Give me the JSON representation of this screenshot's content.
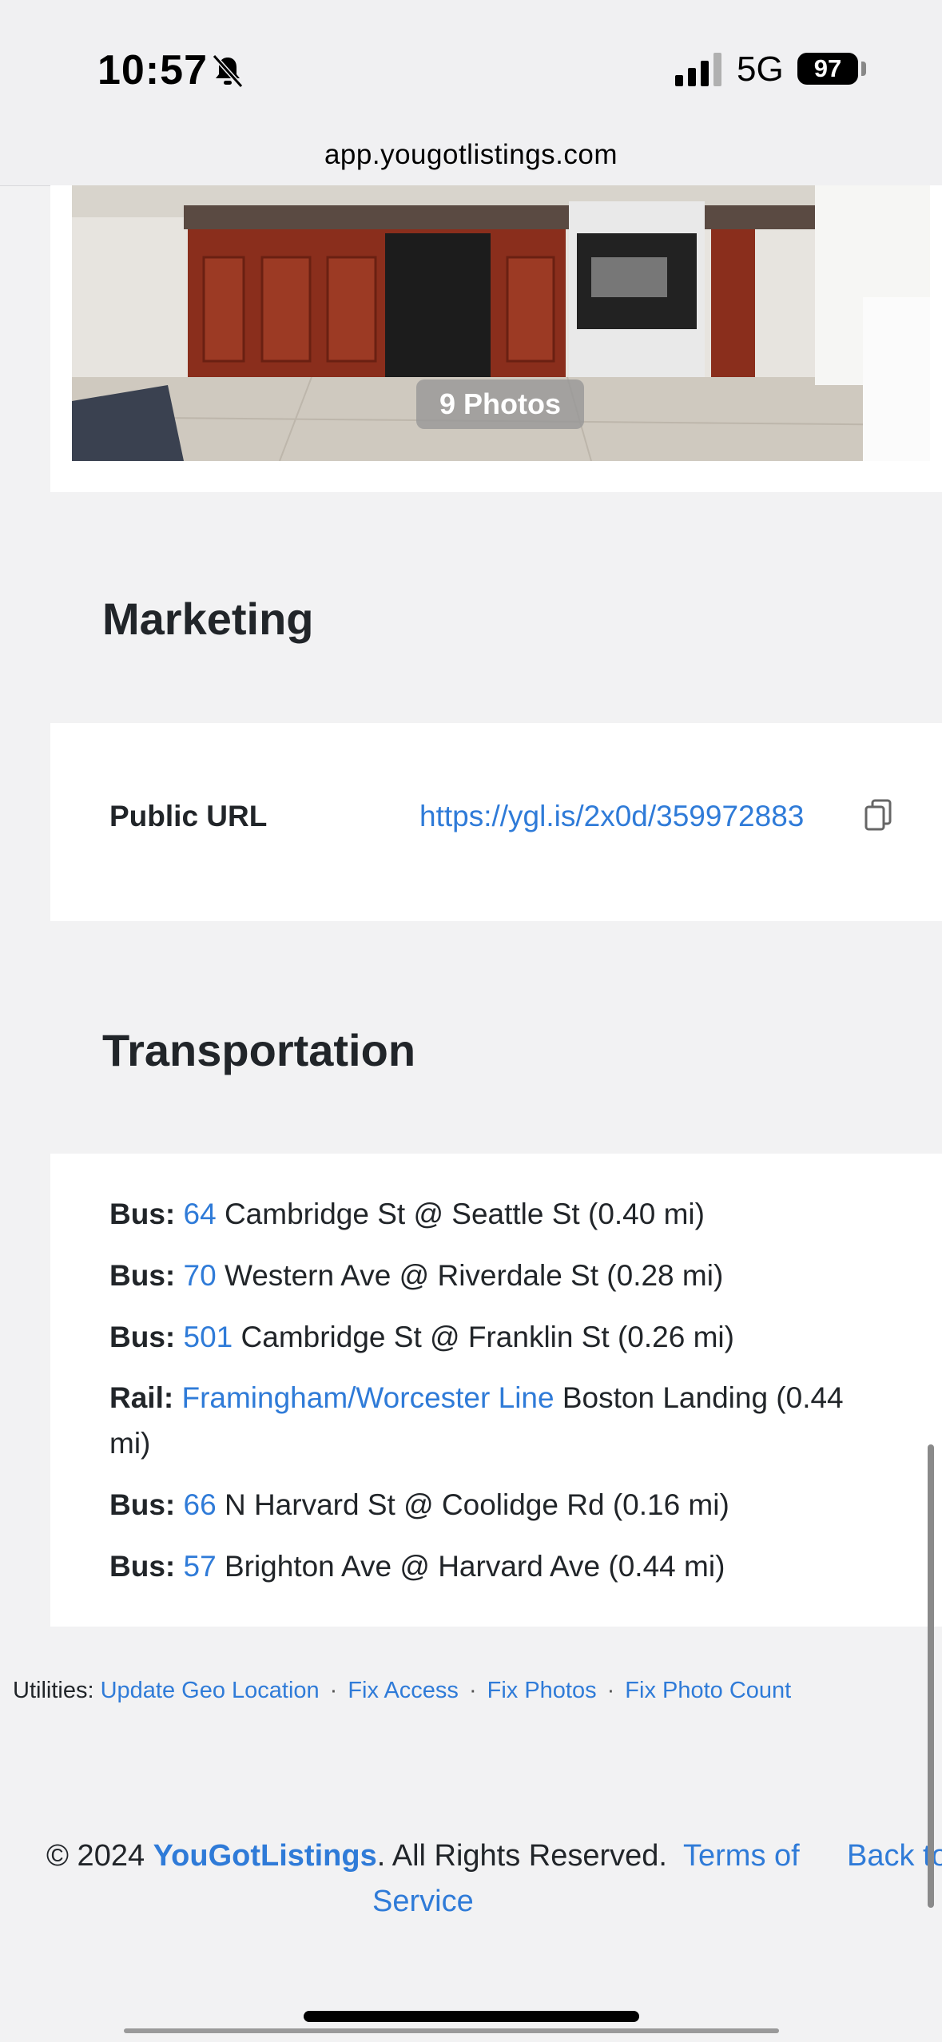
{
  "status_bar": {
    "time": "10:57",
    "network": "5G",
    "battery": "97",
    "url": "app.yougotlistings.com"
  },
  "photos": {
    "badge": "9 Photos"
  },
  "marketing": {
    "heading": "Marketing",
    "public_url_label": "Public URL",
    "public_url": "https://ygl.is/2x0d/359972883"
  },
  "transportation": {
    "heading": "Transportation",
    "items": [
      {
        "type": "Bus:",
        "line": "64",
        "stop": "Cambridge St @ Seattle St (0.40 mi)"
      },
      {
        "type": "Bus:",
        "line": "70",
        "stop": "Western Ave @ Riverdale St (0.28 mi)"
      },
      {
        "type": "Bus:",
        "line": "501",
        "stop": "Cambridge St @ Franklin St (0.26 mi)"
      },
      {
        "type": "Rail:",
        "line": "Framingham/Worcester Line",
        "stop": "Boston Landing (0.44 mi)"
      },
      {
        "type": "Bus:",
        "line": "66",
        "stop": "N Harvard St @ Coolidge Rd (0.16 mi)"
      },
      {
        "type": "Bus:",
        "line": "57",
        "stop": "Brighton Ave @ Harvard Ave (0.44 mi)"
      }
    ]
  },
  "utilities": {
    "label": "Utilities:",
    "links": [
      "Update Geo Location",
      "Fix Access",
      "Fix Photos",
      "Fix Photo Count"
    ],
    "separator": "·"
  },
  "footer": {
    "copyright": "© 2024",
    "brand": "YouGotListings",
    "rights": ". All Rights Reserved.",
    "terms_line1": "Terms of",
    "terms_line2": "Service",
    "back_to_top": "Back to"
  },
  "colors": {
    "link": "#2f7bd8",
    "background": "#f2f2f3",
    "card": "#ffffff"
  }
}
